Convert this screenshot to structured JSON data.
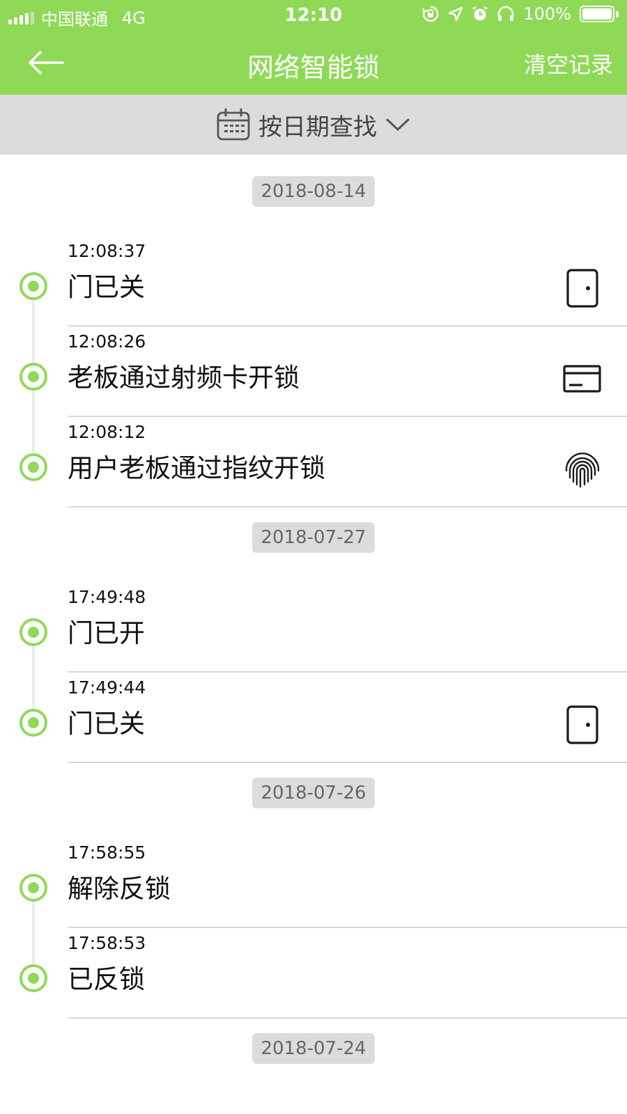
{
  "status_bar": {
    "carrier": "中国联通",
    "network": "4G",
    "time": "12:10",
    "battery": "100%",
    "battery_level": 1.0,
    "icons": [
      "rotation-lock-icon",
      "location-icon",
      "alarm-icon",
      "headphones-icon",
      "battery-icon"
    ]
  },
  "nav": {
    "title": "网络智能锁",
    "back_icon": "arrow-left-icon",
    "clear_label": "清空记录"
  },
  "filter": {
    "label": "按日期查找",
    "icon": "calendar-icon",
    "caret": "chevron-down-icon"
  },
  "colors": {
    "accent": "#8fd957",
    "filter_bg": "#dcdcdc",
    "badge_bg": "#dcdcdc"
  },
  "groups": [
    {
      "date": "2018-08-14",
      "events": [
        {
          "time": "12:08:37",
          "title": "门已关",
          "icon": "door-icon"
        },
        {
          "time": "12:08:26",
          "title": "老板通过射频卡开锁",
          "icon": "card-icon"
        },
        {
          "time": "12:08:12",
          "title": "用户老板通过指纹开锁",
          "icon": "fingerprint-icon"
        }
      ]
    },
    {
      "date": "2018-07-27",
      "events": [
        {
          "time": "17:49:48",
          "title": "门已开",
          "icon": ""
        },
        {
          "time": "17:49:44",
          "title": "门已关",
          "icon": "door-icon"
        }
      ]
    },
    {
      "date": "2018-07-26",
      "events": [
        {
          "time": "17:58:55",
          "title": "解除反锁",
          "icon": ""
        },
        {
          "time": "17:58:53",
          "title": "已反锁",
          "icon": ""
        }
      ]
    },
    {
      "date": "2018-07-24",
      "events": []
    }
  ]
}
